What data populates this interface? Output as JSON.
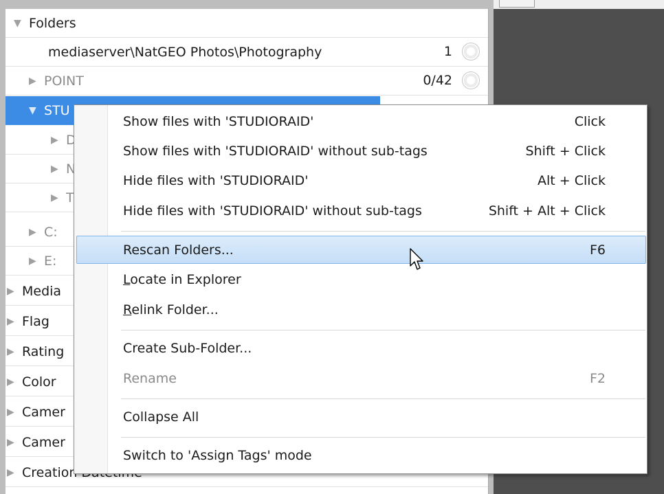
{
  "tree": {
    "folders_header": "Folders",
    "rows": [
      {
        "label": "mediaserver\\NatGEO Photos\\Photography",
        "count": "1"
      },
      {
        "label": "POINT",
        "count": "0/42"
      },
      {
        "label": "STU"
      },
      {
        "label": "D"
      },
      {
        "label": "N"
      },
      {
        "label": "T"
      },
      {
        "label": "C:"
      },
      {
        "label": "E:"
      }
    ],
    "sections": [
      "Media",
      "Flag",
      "Rating",
      "Color",
      "Camer",
      "Camer",
      "Creation Datetime"
    ]
  },
  "menu": {
    "items": [
      {
        "label": "Show files with 'STUDIORAID'",
        "shortcut": "Click"
      },
      {
        "label": "Show files with 'STUDIORAID' without sub-tags",
        "shortcut": "Shift + Click"
      },
      {
        "label": "Hide files with 'STUDIORAID'",
        "shortcut": "Alt + Click"
      },
      {
        "label": "Hide files with 'STUDIORAID' without sub-tags",
        "shortcut": "Shift + Alt + Click"
      },
      {
        "label": "Rescan Folders...",
        "shortcut": "F6"
      },
      {
        "label": "Locate in Explorer",
        "shortcut": ""
      },
      {
        "label": "Relink Folder...",
        "shortcut": ""
      },
      {
        "label": "Create Sub-Folder...",
        "shortcut": ""
      },
      {
        "label": "Rename",
        "shortcut": "F2"
      },
      {
        "label": "Collapse All",
        "shortcut": ""
      },
      {
        "label": "Switch to 'Assign Tags' mode",
        "shortcut": ""
      }
    ],
    "mnemonics": {
      "locate_first": "L",
      "locate_rest": "ocate in Explorer",
      "relink_first": "R",
      "relink_rest": "elink Folder..."
    }
  },
  "colors": {
    "selection": "#3c8ce6",
    "menu_highlight": "#c5def7",
    "dark_pane": "#4e4e4e"
  }
}
